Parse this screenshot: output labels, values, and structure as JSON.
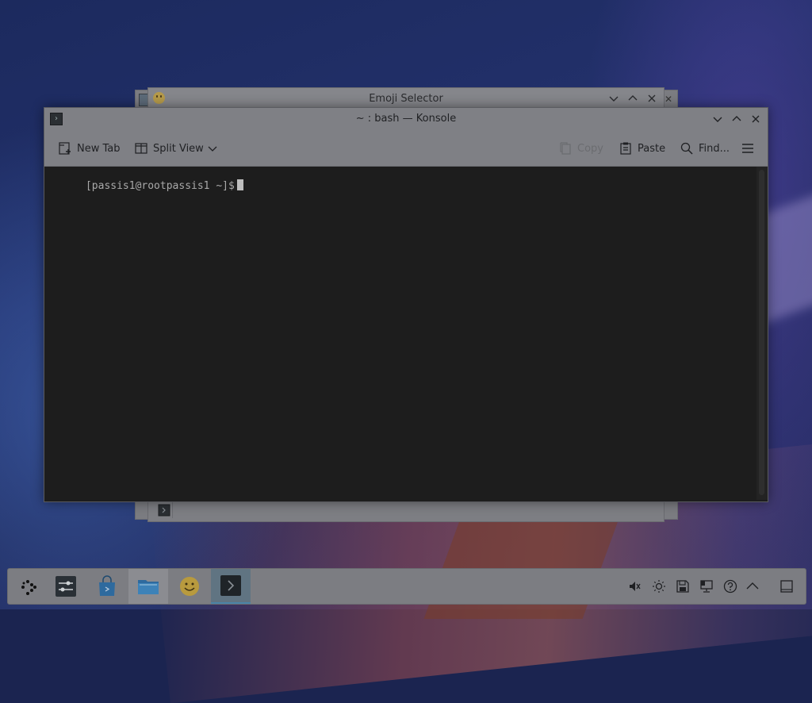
{
  "emoji_window": {
    "title": "Emoji Selector"
  },
  "konsole": {
    "title": "~ : bash — Konsole",
    "toolbar": {
      "new_tab": "New Tab",
      "split_view": "Split View",
      "copy": "Copy",
      "paste": "Paste",
      "find": "Find..."
    },
    "terminal": {
      "prompt": "[passis1@rootpassis1 ~]$"
    }
  },
  "taskbar": {
    "items": [
      {
        "name": "application-launcher",
        "icon": "launcher-icon"
      },
      {
        "name": "system-settings",
        "icon": "settings-sliders-icon"
      },
      {
        "name": "discover",
        "icon": "store-bag-icon"
      },
      {
        "name": "dolphin",
        "icon": "folder-icon"
      },
      {
        "name": "emoji-selector",
        "icon": "smiley-icon"
      },
      {
        "name": "konsole",
        "icon": "terminal-icon"
      }
    ],
    "tray": [
      "volume-muted-icon",
      "brightness-icon",
      "save-icon",
      "network-icon",
      "help-icon",
      "expand-tray-icon",
      "show-desktop-icon"
    ]
  }
}
